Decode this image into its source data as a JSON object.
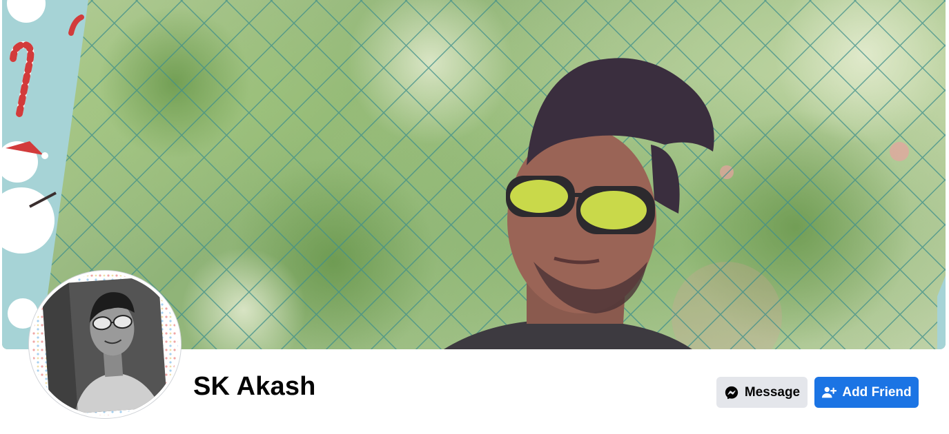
{
  "profile": {
    "name": "SK Akash"
  },
  "cover": {
    "image": "cover-photo"
  },
  "avatar": {
    "image": "profile-picture"
  },
  "actions": {
    "message_label": "Message",
    "add_friend_label": "Add Friend"
  },
  "colors": {
    "primary_button": "#1b74e4",
    "secondary_button": "#e4e6eb",
    "text": "#050505"
  },
  "icons": {
    "message": "messenger-icon",
    "add_friend": "add-friend-icon"
  }
}
